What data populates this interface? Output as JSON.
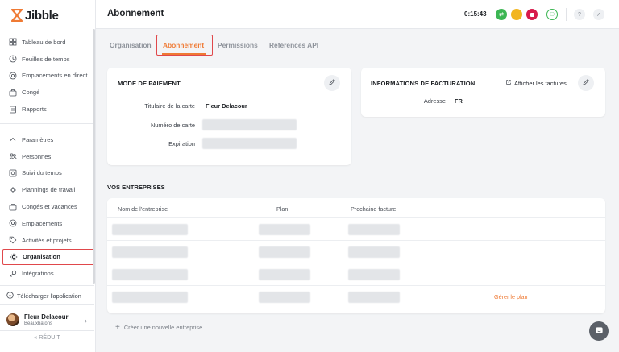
{
  "app": {
    "logo_text": "Jibble"
  },
  "sidebar": {
    "items_top": [
      {
        "label": "Tableau de bord",
        "icon": "dashboard-icon"
      },
      {
        "label": "Feuilles de temps",
        "icon": "clock-icon"
      },
      {
        "label": "Emplacements en direct",
        "icon": "location-icon"
      },
      {
        "label": "Congé",
        "icon": "suitcase-icon"
      },
      {
        "label": "Rapports",
        "icon": "report-icon"
      }
    ],
    "items_settings": [
      {
        "label": "Paramètres",
        "icon": "chevron-up-icon"
      },
      {
        "label": "Personnes",
        "icon": "people-icon"
      },
      {
        "label": "Suivi du temps",
        "icon": "time-tracking-icon"
      },
      {
        "label": "Plannings de travail",
        "icon": "schedule-icon"
      },
      {
        "label": "Congés et vacances",
        "icon": "suitcase-icon"
      },
      {
        "label": "Emplacements",
        "icon": "location-icon"
      },
      {
        "label": "Activités et projets",
        "icon": "tag-icon"
      },
      {
        "label": "Organisation",
        "icon": "gear-icon",
        "active": true
      },
      {
        "label": "Intégrations",
        "icon": "key-icon"
      }
    ],
    "download_label": "Télécharger l'application",
    "user": {
      "name": "Fleur Delacour",
      "org": "Beauxbatons"
    },
    "collapse_label": "RÉDUIT"
  },
  "topbar": {
    "title": "Abonnement",
    "timer": "0:15:43",
    "colors": {
      "green": "#3cb653",
      "yellow": "#f2b51f",
      "red": "#d81b4b"
    }
  },
  "tabs": [
    {
      "label": "Organisation",
      "active": false
    },
    {
      "label": "Abonnement",
      "active": true
    },
    {
      "label": "Permissions",
      "active": false
    },
    {
      "label": "Références API",
      "active": false
    }
  ],
  "payment": {
    "title": "MODE DE PAIEMENT",
    "cardholder_label": "Titulaire de la carte",
    "cardholder_value": "Fleur Delacour",
    "card_number_label": "Numéro de carte",
    "expiry_label": "Expiration"
  },
  "billing": {
    "title": "INFORMATIONS DE FACTURATION",
    "view_invoices": "Afficher les factures",
    "address_label": "Adresse",
    "address_value": "FR"
  },
  "companies": {
    "title": "VOS ENTREPRISES",
    "columns": [
      "Nom de l'entreprise",
      "Plan",
      "Prochaine facture"
    ],
    "manage_plan": "Gérer le plan",
    "create_label": "Créer une nouvelle entreprise"
  }
}
